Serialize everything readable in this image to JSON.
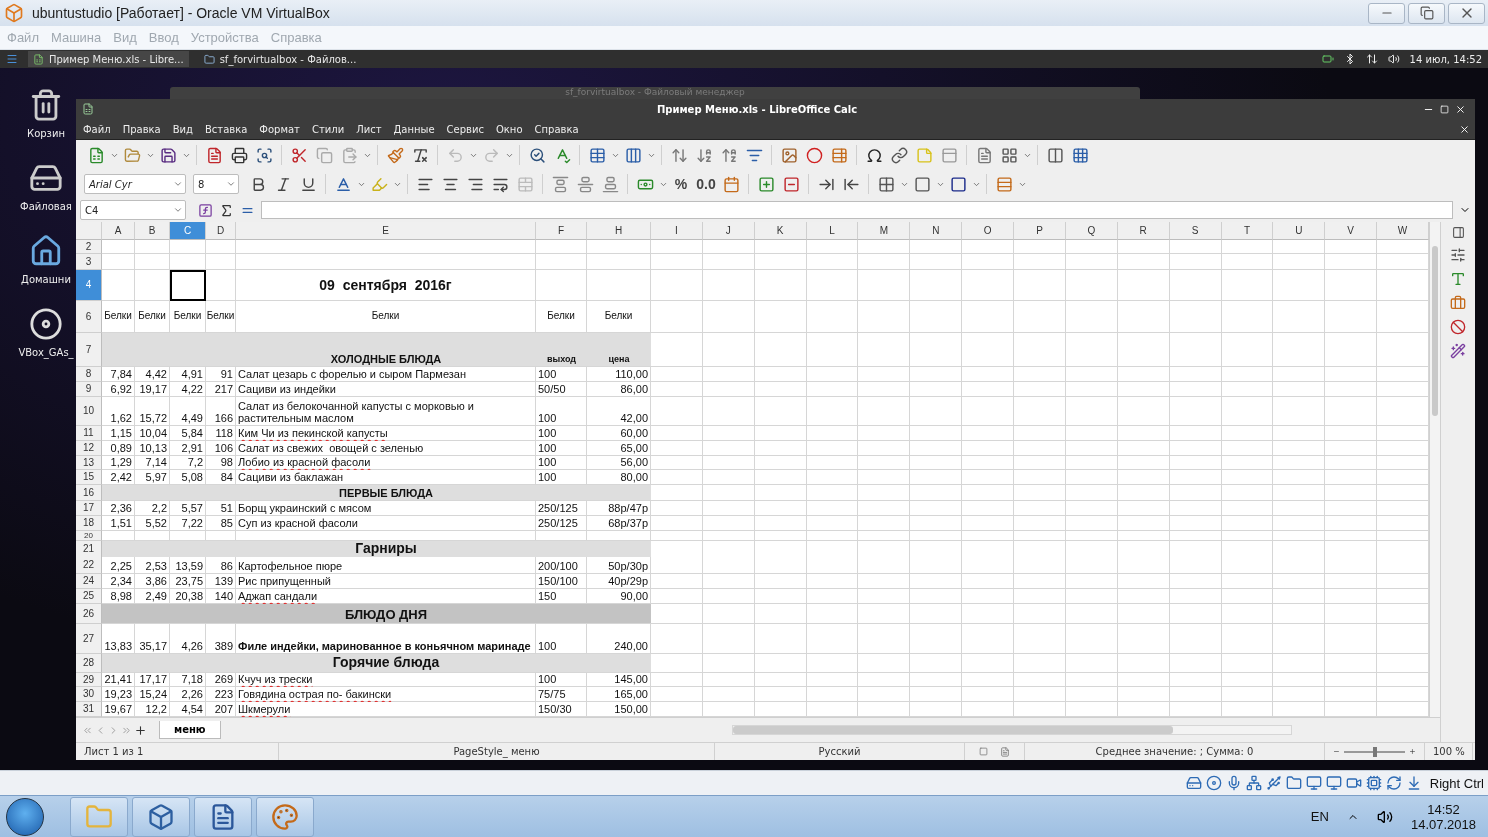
{
  "vbox": {
    "title": "ubuntustudio [Работает] - Oracle VM VirtualBox",
    "menu": [
      "Файл",
      "Машина",
      "Вид",
      "Ввод",
      "Устройства",
      "Справка"
    ],
    "host_key": "Right Ctrl"
  },
  "guest_panel": {
    "tasks": [
      {
        "label": "Пример Меню.xls - Libre...",
        "kind": "sheet",
        "selected": true
      },
      {
        "label": "sf_forvirtualbox - Файлов...",
        "kind": "folder",
        "selected": false
      }
    ],
    "clock": "14 июл, 14:52"
  },
  "desktop_icons": [
    {
      "label": "Корзин",
      "kind": "trash"
    },
    {
      "label": "Файловая",
      "kind": "drive"
    },
    {
      "label": "Домашни",
      "kind": "home"
    },
    {
      "label": "VBox_GAs_",
      "kind": "disc"
    }
  ],
  "back_window": {
    "title": "sf_forvirtualbox - Файловый менеджер"
  },
  "calc": {
    "title": "Пример Меню.xls - LibreOffice Calc",
    "menu": [
      "Файл",
      "Правка",
      "Вид",
      "Вставка",
      "Формат",
      "Стили",
      "Лист",
      "Данные",
      "Сервис",
      "Окно",
      "Справка"
    ],
    "font_name": "Arial Cyr",
    "font_size": "8",
    "number_formats": [
      "%",
      "0.0"
    ],
    "name_box": "C4",
    "columns": [
      {
        "label": "A",
        "selected": false
      },
      {
        "label": "B",
        "selected": false
      },
      {
        "label": "C",
        "selected": true
      },
      {
        "label": "D",
        "selected": false
      },
      {
        "label": "E",
        "selected": false
      },
      {
        "label": "F",
        "selected": false
      },
      {
        "label": "H",
        "selected": false
      },
      {
        "label": "I",
        "selected": false
      },
      {
        "label": "J",
        "selected": false
      },
      {
        "label": "K",
        "selected": false
      },
      {
        "label": "L",
        "selected": false
      },
      {
        "label": "M",
        "selected": false
      },
      {
        "label": "N",
        "selected": false
      },
      {
        "label": "O",
        "selected": false
      },
      {
        "label": "P",
        "selected": false
      },
      {
        "label": "Q",
        "selected": false
      },
      {
        "label": "R",
        "selected": false
      },
      {
        "label": "S",
        "selected": false
      },
      {
        "label": "T",
        "selected": false
      },
      {
        "label": "U",
        "selected": false
      },
      {
        "label": "V",
        "selected": false
      },
      {
        "label": "W",
        "selected": false
      }
    ],
    "rows": [
      {
        "number": "2",
        "kind": "blank",
        "selected": false
      },
      {
        "number": "3",
        "kind": "blank",
        "selected": false
      },
      {
        "number": "4",
        "kind": "title",
        "selected": true,
        "text": "09  сентября  2016г"
      },
      {
        "number": "6",
        "kind": "header",
        "selected": false,
        "cells": [
          "Белки",
          "Белки",
          "Белки",
          "Белки",
          "Белки",
          "Белки",
          "Белки"
        ]
      },
      {
        "number": "7",
        "kind": "section",
        "selected": false,
        "text": "ХОЛОДНЫЕ БЛЮДА",
        "labels": [
          "выход",
          "цена"
        ]
      },
      {
        "number": "8",
        "kind": "item",
        "selected": false,
        "flagged": false,
        "cells": [
          "7,84",
          "4,42",
          "4,91",
          "91",
          "Салат цезарь с форелью и сыром Пармезан",
          "100",
          "110,00"
        ]
      },
      {
        "number": "9",
        "kind": "item",
        "selected": false,
        "flagged": false,
        "cells": [
          "6,92",
          "19,17",
          "4,22",
          "217",
          "Сациви из индейки",
          "50/50",
          "86,00"
        ]
      },
      {
        "number": "10",
        "kind": "item",
        "selected": false,
        "flagged": false,
        "cells": [
          "1,62",
          "15,72",
          "4,49",
          "166",
          "Салат из белокочанной капусты с морковью и растительным маслом",
          "100",
          "42,00"
        ]
      },
      {
        "number": "11",
        "kind": "item",
        "selected": false,
        "flagged": true,
        "cells": [
          "1,15",
          "10,04",
          "5,84",
          "118",
          "Ким Чи из пекинской капусты",
          "100",
          "60,00"
        ]
      },
      {
        "number": "12",
        "kind": "item",
        "selected": false,
        "flagged": false,
        "cells": [
          "0,89",
          "10,13",
          "2,91",
          "106",
          "Салат из свежих  овощей с зеленью",
          "100",
          "65,00"
        ]
      },
      {
        "number": "13",
        "kind": "item",
        "selected": false,
        "flagged": true,
        "cells": [
          "1,29",
          "7,14",
          "7,2",
          "98",
          "Лобио из красной фасоли",
          "100",
          "56,00"
        ]
      },
      {
        "number": "15",
        "kind": "item",
        "selected": false,
        "flagged": false,
        "cells": [
          "2,42",
          "5,97",
          "5,08",
          "84",
          "Сациви из баклажан",
          "100",
          "80,00"
        ]
      },
      {
        "number": "16",
        "kind": "section",
        "selected": false,
        "text": "ПЕРВЫЕ БЛЮДА"
      },
      {
        "number": "17",
        "kind": "item",
        "selected": false,
        "flagged": false,
        "cells": [
          "2,36",
          "2,2",
          "5,57",
          "51",
          "Борщ украинский с мясом",
          "250/125",
          "88р/47р"
        ]
      },
      {
        "number": "18",
        "kind": "item",
        "selected": false,
        "flagged": false,
        "cells": [
          "1,51",
          "5,52",
          "7,22",
          "85",
          "Суп из красной фасоли",
          "250/125",
          "68р/37р"
        ]
      },
      {
        "number": "20",
        "kind": "blank",
        "selected": false
      },
      {
        "number": "21",
        "kind": "group",
        "selected": false,
        "text": "Гарниры"
      },
      {
        "number": "22",
        "kind": "item",
        "selected": false,
        "flagged": false,
        "cells": [
          "2,25",
          "2,53",
          "13,59",
          "86",
          "Картофельное пюре",
          "200/100",
          "50р/30р"
        ]
      },
      {
        "number": "24",
        "kind": "item",
        "selected": false,
        "flagged": false,
        "cells": [
          "2,34",
          "3,86",
          "23,75",
          "139",
          "Рис припущенный",
          "150/100",
          "40р/29р"
        ]
      },
      {
        "number": "25",
        "kind": "item",
        "selected": false,
        "flagged": true,
        "cells": [
          "8,98",
          "2,49",
          "20,38",
          "140",
          "Аджап сандали",
          "150",
          "90,00"
        ]
      },
      {
        "number": "26",
        "kind": "feature_section",
        "selected": false,
        "text": "БЛЮДО ДНЯ"
      },
      {
        "number": "27",
        "kind": "feature_item",
        "selected": false,
        "flagged": false,
        "cells": [
          "13,83",
          "35,17",
          "4,26",
          "389",
          "Филе индейки, маринованное в коньячном маринаде",
          "100",
          "240,00"
        ]
      },
      {
        "number": "28",
        "kind": "group",
        "selected": false,
        "text": "Горячие блюда"
      },
      {
        "number": "29",
        "kind": "item",
        "selected": false,
        "flagged": true,
        "cells": [
          "21,41",
          "17,17",
          "7,18",
          "269",
          "Кчуч из трески",
          "100",
          "145,00"
        ]
      },
      {
        "number": "30",
        "kind": "item",
        "selected": false,
        "flagged": true,
        "cells": [
          "19,23",
          "15,24",
          "2,26",
          "223",
          "Говядина острая по- бакински",
          "75/75",
          "165,00"
        ]
      },
      {
        "number": "31",
        "kind": "item",
        "selected": false,
        "flagged": true,
        "cells": [
          "19,67",
          "12,2",
          "4,54",
          "207",
          "Шкмерули",
          "150/30",
          "150,00"
        ]
      }
    ],
    "sheet_tabs": [
      {
        "label": "меню",
        "selected": true
      }
    ],
    "status": {
      "sheet": "Лист 1 из 1",
      "page_style": "PageStyle_ меню",
      "language": "Русский",
      "summary": "Среднее значение: ; Сумма: 0",
      "zoom": "100 %",
      "zoom_slider": {
        "level": 0.5
      }
    }
  },
  "taskbar": {
    "apps": [
      {
        "kind": "explorer"
      },
      {
        "kind": "virtualbox"
      },
      {
        "kind": "word"
      },
      {
        "kind": "paint"
      }
    ],
    "language": "EN",
    "time": "14:52",
    "date": "14.07.2018"
  }
}
